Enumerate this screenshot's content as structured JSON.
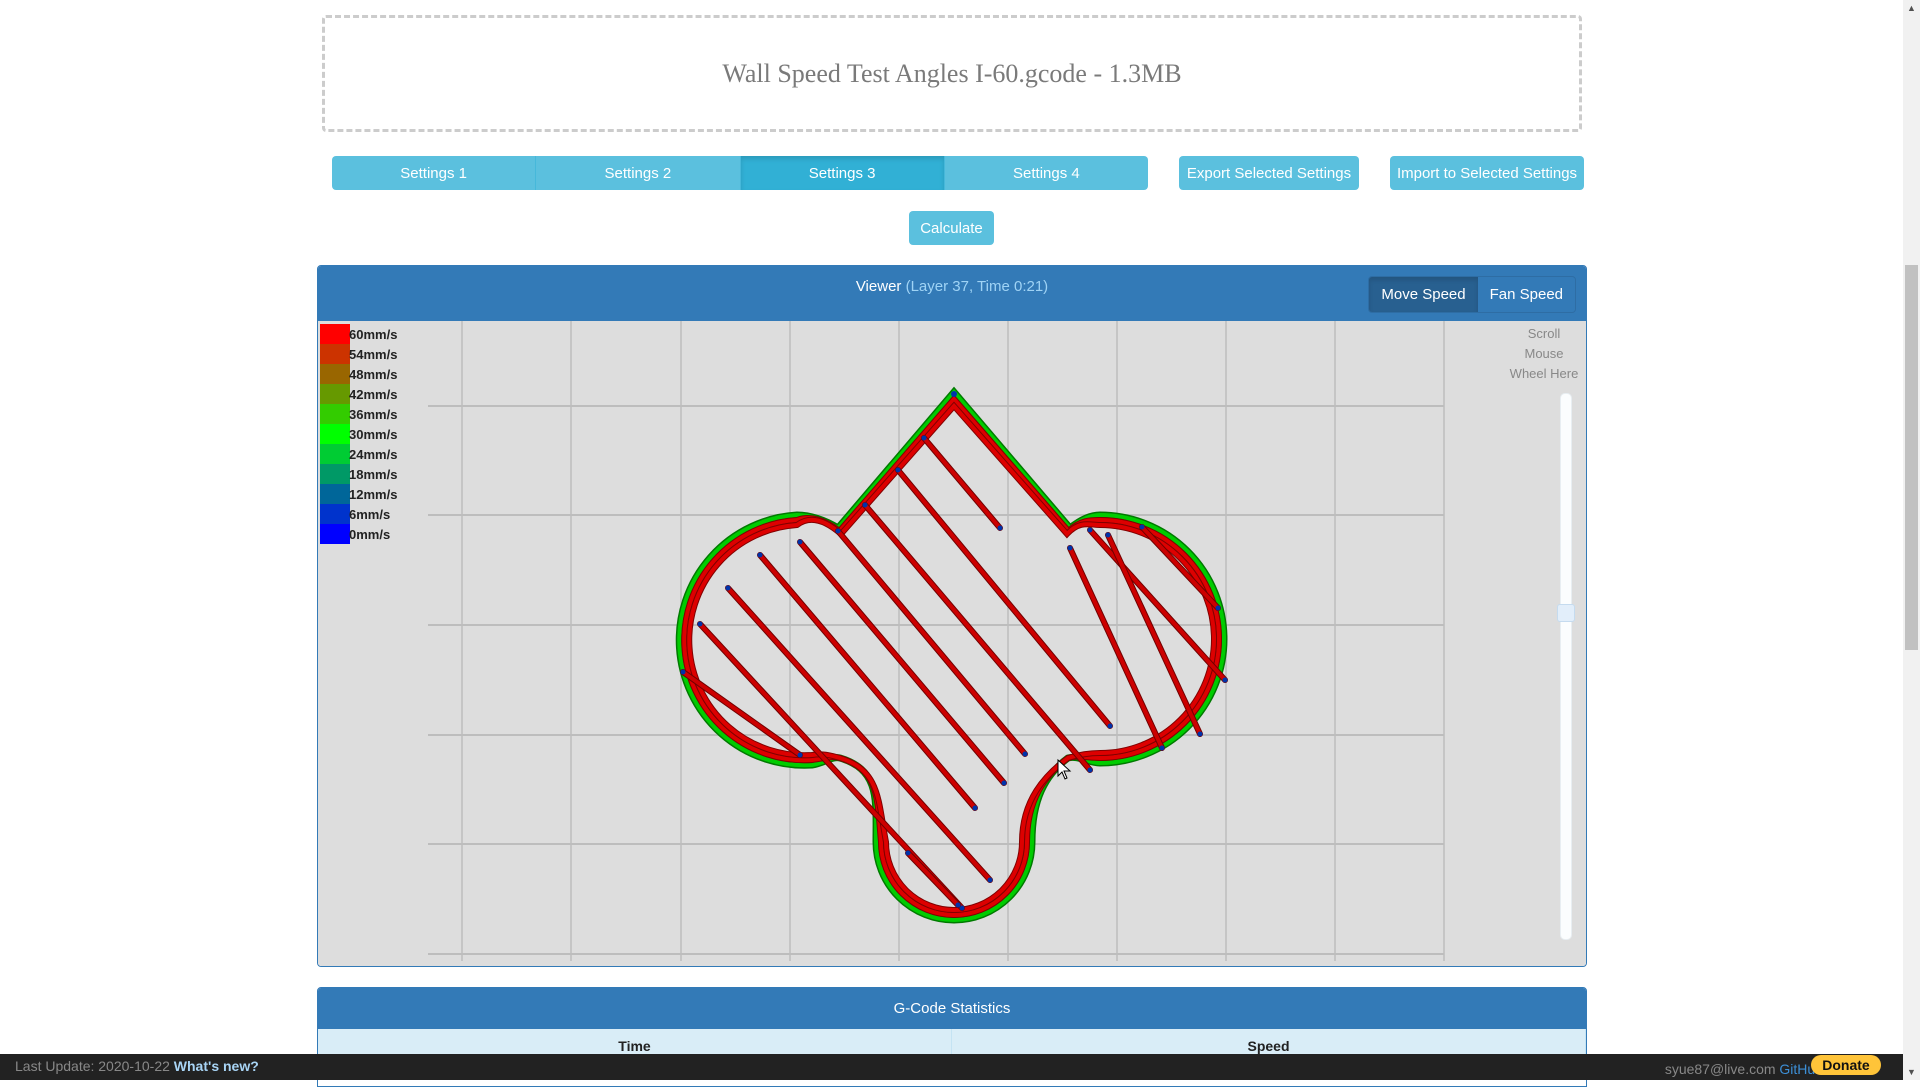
{
  "file": {
    "label": "Wall Speed Test Angles I-60.gcode - 1.3MB"
  },
  "settings_tabs": [
    {
      "label": "Settings 1",
      "active": false
    },
    {
      "label": "Settings 2",
      "active": false
    },
    {
      "label": "Settings 3",
      "active": true
    },
    {
      "label": "Settings 4",
      "active": false
    }
  ],
  "actions": {
    "export_label": "Export Selected Settings",
    "import_label": "Import to Selected Settings",
    "calculate_label": "Calculate"
  },
  "viewer": {
    "title": "Viewer",
    "subtitle": "(Layer 37, Time 0:21)",
    "layer": 37,
    "time": "0:21",
    "modes": [
      {
        "label": "Move Speed",
        "active": true
      },
      {
        "label": "Fan Speed",
        "active": false
      }
    ],
    "scroll_hint": [
      "Scroll",
      "Mouse",
      "Wheel Here"
    ],
    "layer_slider_fraction_from_top": 0.4,
    "legend": [
      {
        "label": "60mm/s",
        "color": "#ff0000"
      },
      {
        "label": "54mm/s",
        "color": "#cc3300"
      },
      {
        "label": "48mm/s",
        "color": "#996600"
      },
      {
        "label": "42mm/s",
        "color": "#669900"
      },
      {
        "label": "36mm/s",
        "color": "#33cc00"
      },
      {
        "label": "30mm/s",
        "color": "#00ff00"
      },
      {
        "label": "24mm/s",
        "color": "#00cc33"
      },
      {
        "label": "18mm/s",
        "color": "#009966"
      },
      {
        "label": "12mm/s",
        "color": "#006699"
      },
      {
        "label": "6mm/s",
        "color": "#0033cc"
      },
      {
        "label": "0mm/s",
        "color": "#0000ff"
      }
    ],
    "path_colors": {
      "wall_outer": "#00cc00",
      "wall_inner": "#dd0000",
      "infill": "#cc0000",
      "turn": "#0033aa"
    }
  },
  "statistics": {
    "title": "G-Code Statistics",
    "columns": [
      "Time",
      "Speed"
    ]
  },
  "footer": {
    "last_update_label": "Last Update: 2020-10-22",
    "whats_new": "What's new?",
    "email": "syue87@live.com",
    "github": "GitHub",
    "donate": "Donate"
  }
}
